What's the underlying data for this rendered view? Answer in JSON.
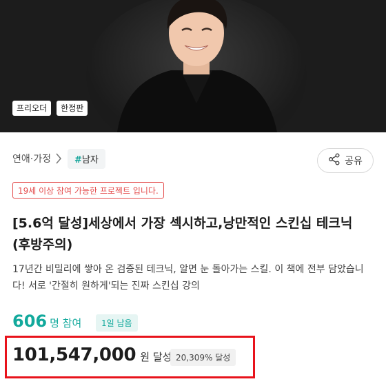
{
  "hero": {
    "badges": [
      "프리오더",
      "한정판"
    ]
  },
  "category": {
    "path": "연애·가정",
    "tag_hash": "#",
    "tag_label": "남자"
  },
  "share": {
    "label": "공유"
  },
  "age_notice": "19세 이상 참여 가능한 프로젝트 입니다.",
  "title": "[5.6억 달성]세상에서 가장 섹시하고,낭만적인 스킨십 테크닉 (후방주의)",
  "description": "17년간 비밀리에 쌓아 온 검증된 테크닉, 알면 눈 돌아가는 스킬. 이 책에 전부 담았습니다! 서로 '간절히 원하게'되는 진짜 스킨십 강의",
  "participants": {
    "count": "606",
    "unit": "명 참여",
    "days_left": "1일 남음"
  },
  "funding": {
    "amount": "101,547,000",
    "unit": "원 달성",
    "percent": "20,309% 달성"
  },
  "colors": {
    "accent": "#12a99c",
    "highlight_box": "#e8121b",
    "notice": "#e44b4b"
  }
}
